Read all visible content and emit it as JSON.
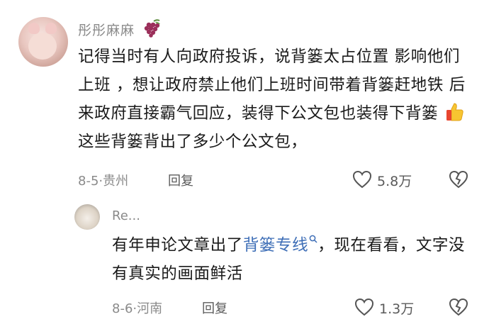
{
  "comment": {
    "username": "彤彤麻麻",
    "username_emoji": "grapes-icon",
    "text_part1": "记得当时有人向政府投诉，说背篓太占位置 影响他们上班 ，想让政府禁止他们上班时间带着背篓赶地铁 后来政府直接霸气回应，装得下公文包也装得下背篓",
    "text_part2": "这些背篓背出了多少个公文包，",
    "emoji": "thumbs-up-icon",
    "date_location": "8-5·贵州",
    "reply_label": "回复",
    "like_count": "5.8万"
  },
  "reply": {
    "username": "Re...",
    "text_part1": "有年申论文章出了",
    "link_text": "背篓专线",
    "text_part2": "，现在看看，文字没有真实的画面鲜活",
    "date_location": "8-6·河南",
    "reply_label": "回复",
    "like_count": "1.3万"
  },
  "colors": {
    "link": "#3f6fb7",
    "meta": "#8a8a8a",
    "text": "#1a1a1a"
  }
}
